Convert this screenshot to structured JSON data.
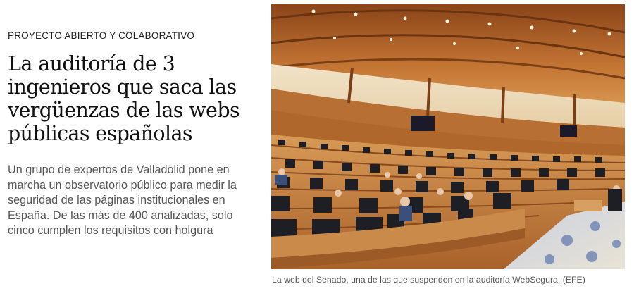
{
  "article": {
    "kicker": "PROYECTO ABIERTO Y COLABORATIVO",
    "headline_lines": [
      "La auditoría de 3",
      "ingenieros que saca las",
      "vergüenzas de las webs",
      "públicas españolas"
    ],
    "summary_lines": [
      "Un grupo de expertos de Valladolid pone en",
      "marcha un observatorio público para medir la",
      "seguridad de las páginas institucionales en",
      "España. De las más de 400 analizadas, solo",
      "cinco cumplen los requisitos con holgura"
    ]
  },
  "photo": {
    "description_icon": "senate-chamber-photo",
    "caption": "La web del Senado, una de las que suspenden en la auditoría WebSegura. (EFE)"
  },
  "colors": {
    "wood": "#b0672c",
    "wood_dark": "#7a3f17",
    "seat": "#1d1f24",
    "carpet": "#cfd5e6",
    "text_dark": "#111111",
    "text_muted": "#555555"
  }
}
